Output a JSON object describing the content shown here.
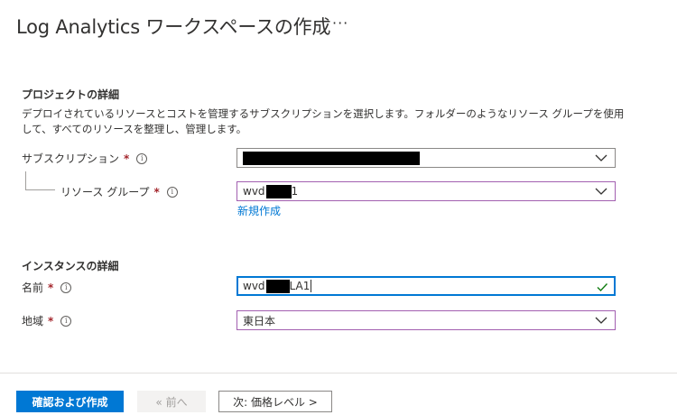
{
  "page_title": "Log Analytics ワークスペースの作成",
  "more_label": "···",
  "project": {
    "heading": "プロジェクトの詳細",
    "description": "デプロイされているリソースとコストを管理するサブスクリプションを選択します。フォルダーのようなリソース グループを使用して、すべてのリソースを整理し、管理します。",
    "subscription_label": "サブスクリプション",
    "resource_group_label": "リソース グループ",
    "resource_group_prefix": "wvd",
    "resource_group_suffix": "1",
    "create_new_link": "新規作成"
  },
  "instance": {
    "heading": "インスタンスの詳細",
    "name_label": "名前",
    "name_prefix": "wvd",
    "name_suffix": "LA1",
    "region_label": "地域",
    "region_value": "東日本"
  },
  "required_mark": "*",
  "info_glyph": "i",
  "footer": {
    "review_create": "確認および作成",
    "previous": "« 前へ",
    "next": "次: 価格レベル >"
  },
  "colors": {
    "accent": "#0078d4",
    "required": "#a4262c",
    "valid_check": "#107c10",
    "dropdown_border": "#a25fb0"
  }
}
